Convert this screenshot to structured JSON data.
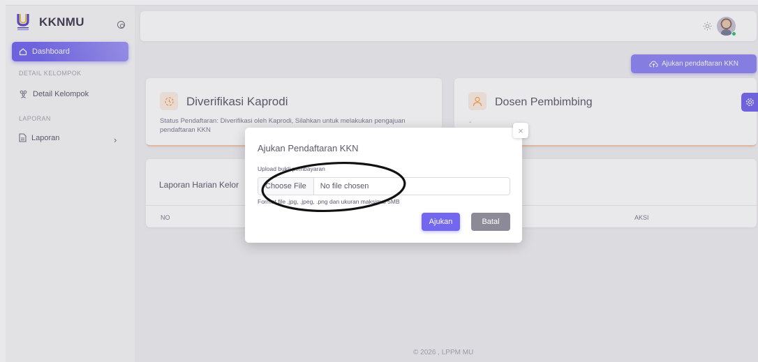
{
  "sidebar": {
    "brand": "KKNMU",
    "active_item": "Dashboard",
    "sections": [
      {
        "header": "DETAIL KELOMPOK",
        "items": [
          "Detail Kelompok"
        ]
      },
      {
        "header": "LAPORAN",
        "items": [
          "Laporan"
        ]
      }
    ]
  },
  "topbar": {
    "theme_icon": "sun-icon",
    "avatar_status": "online"
  },
  "actions": {
    "register_button": "Ajukan pendaftaran KKN"
  },
  "cards": {
    "status": {
      "title": "Diverifikasi Kaprodi",
      "text": "Status Pendaftaran: Diverifikasi oleh Kaprodi, Silahkan untuk melakukan pengajuan pendaftaran KKN"
    },
    "dosen": {
      "title": "Dosen Pembimbing",
      "value": "-"
    },
    "report": {
      "title": "Laporan Harian Kelor",
      "columns": [
        "NO",
        "AKSI"
      ]
    }
  },
  "footer": "© 2026 , LPPM MU",
  "modal": {
    "title": "Ajukan Pendaftaran KKN",
    "upload_label": "Upload bukti pembayaran",
    "file_button": "Choose File",
    "file_status": "No file chosen",
    "format_hint": "Format file .jpg, .jpeg, .png dan ukuran maksimal 5MB",
    "submit": "Ajukan",
    "cancel": "Batal",
    "close": "×"
  },
  "colors": {
    "primary": "#7367f0",
    "primary_light": "#8f85f3",
    "secondary": "#8d8a98",
    "warning_soft": "#fdeee3",
    "warning": "#ff9f43",
    "success": "#28c76f"
  }
}
